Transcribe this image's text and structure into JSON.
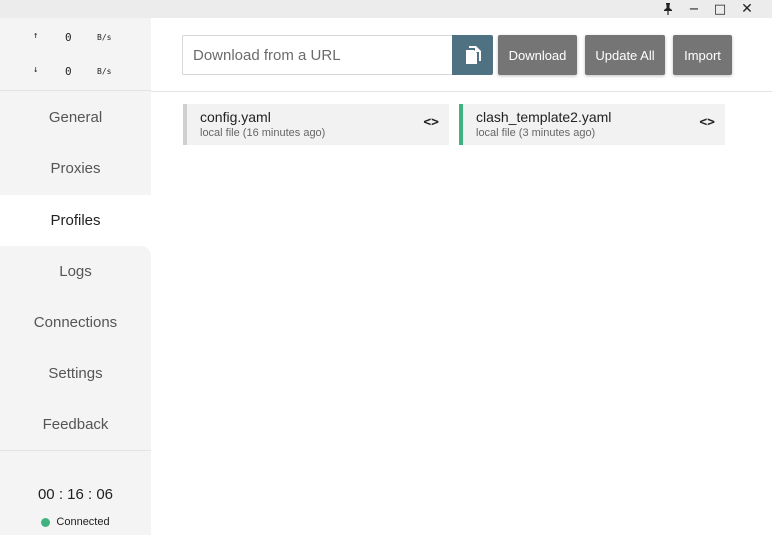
{
  "titlebar": {
    "pin_icon": "pin-icon",
    "minimize_glyph": "−",
    "maximize_glyph": "□",
    "close_glyph": "✕"
  },
  "traffic": {
    "up_arrow": "↑",
    "up_value": "0",
    "up_unit": "B/s",
    "down_arrow": "↓",
    "down_value": "0",
    "down_unit": "B/s"
  },
  "nav": {
    "items": [
      {
        "label": "General"
      },
      {
        "label": "Proxies"
      },
      {
        "label": "Profiles"
      },
      {
        "label": "Logs"
      },
      {
        "label": "Connections"
      },
      {
        "label": "Settings"
      },
      {
        "label": "Feedback"
      }
    ],
    "active": "Profiles"
  },
  "footer": {
    "timer": "00 : 16 : 06",
    "status": "Connected",
    "status_color": "#3fb27f"
  },
  "header": {
    "url_placeholder": "Download from a URL",
    "url_value": "",
    "download_label": "Download",
    "update_all_label": "Update All",
    "import_label": "Import",
    "paste_button_color": "#4f7283"
  },
  "profiles": [
    {
      "name": "config.yaml",
      "subtitle": "local file (16 minutes ago)",
      "selected": false,
      "edit_glyph": "<>"
    },
    {
      "name": "clash_template2.yaml",
      "subtitle": "local file (3 minutes ago)",
      "selected": true,
      "edit_glyph": "<>"
    }
  ]
}
